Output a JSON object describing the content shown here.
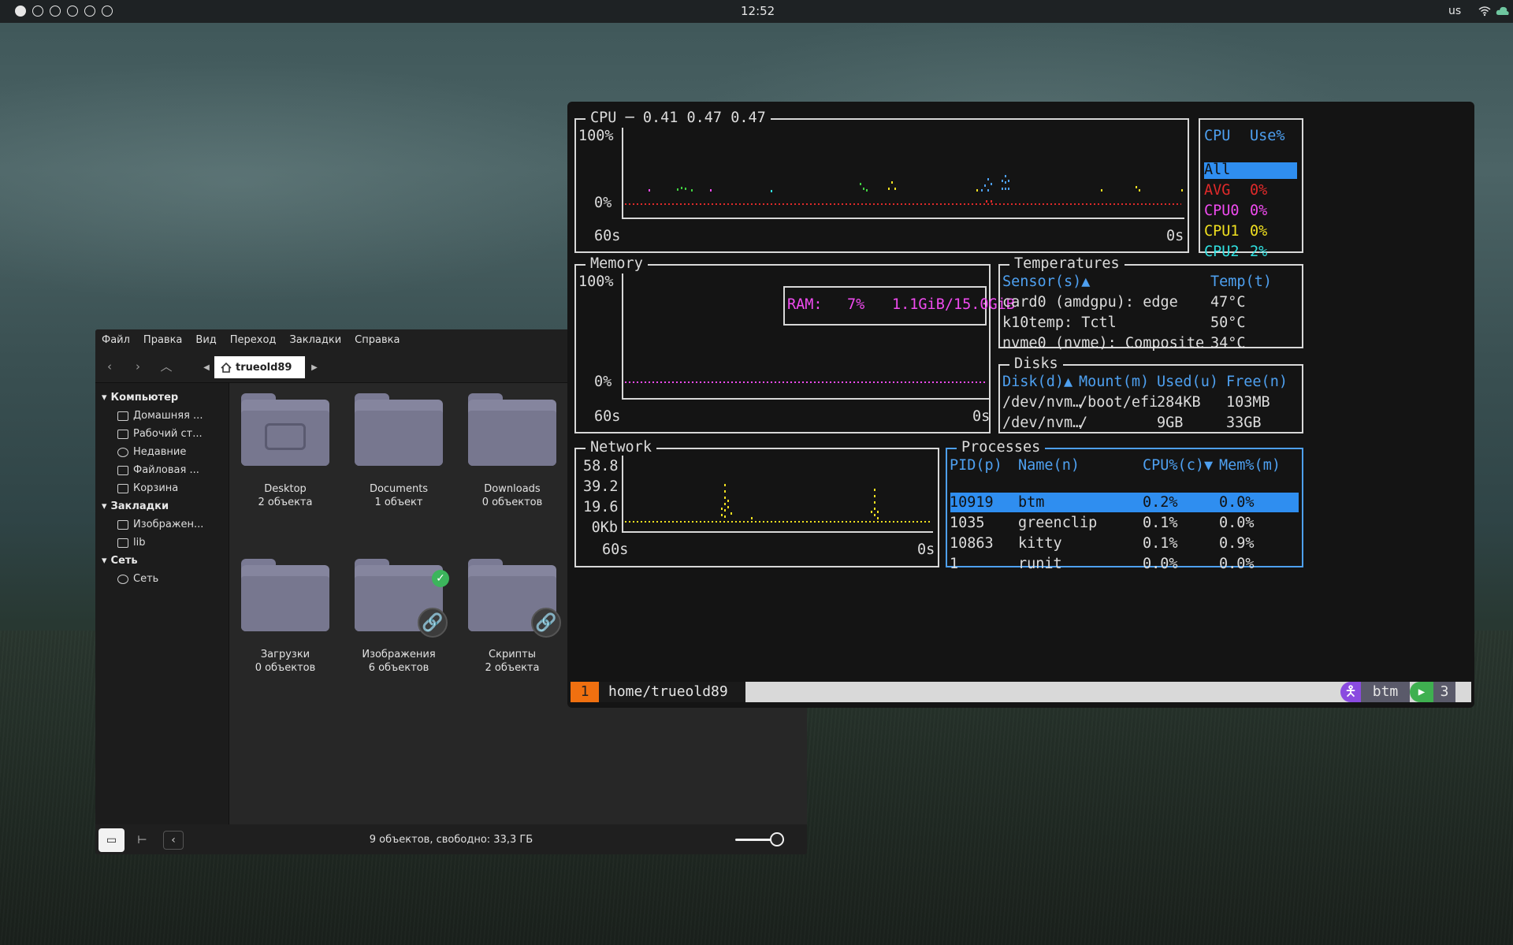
{
  "topbar": {
    "workspaces": [
      true,
      false,
      false,
      false,
      false,
      false
    ],
    "clock": "12:52",
    "keyboard": "us"
  },
  "fm": {
    "menu": [
      "Файл",
      "Правка",
      "Вид",
      "Переход",
      "Закладки",
      "Справка"
    ],
    "path": "trueold89",
    "sidebar": {
      "computer": "Компьютер",
      "computer_items": [
        "Домашняя ...",
        "Рабочий ст...",
        "Недавние",
        "Файловая ...",
        "Корзина"
      ],
      "bookmarks": "Закладки",
      "bookmark_items": [
        "Изображен...",
        "lib"
      ],
      "network": "Сеть",
      "network_items": [
        "Сеть"
      ]
    },
    "items": [
      {
        "name": "Desktop",
        "count": "2 объекта"
      },
      {
        "name": "Documents",
        "count": "1 объект"
      },
      {
        "name": "Downloads",
        "count": "0 объектов"
      },
      {
        "name": "Загрузки",
        "count": "0 объектов"
      },
      {
        "name": "Изображения",
        "count": "6 объектов"
      },
      {
        "name": "Скрипты",
        "count": "2 объекта"
      }
    ],
    "status": "9 объектов, свободно: 33,3 ГБ",
    "zoom_level": 0.85
  },
  "btm": {
    "cpu": {
      "title": "CPU ─ 0.41 0.47 0.47",
      "ymax": "100%",
      "ymin": "0%",
      "xleft": "60s",
      "xright": "0s",
      "legend_h1": "CPU",
      "legend_h2": "Use%",
      "legend": [
        {
          "name": "All",
          "val": ""
        },
        {
          "name": "AVG",
          "val": "0%"
        },
        {
          "name": "CPU0",
          "val": "0%"
        },
        {
          "name": "CPU1",
          "val": "0%"
        },
        {
          "name": "CPU2",
          "val": "2%"
        }
      ]
    },
    "memory": {
      "title": "Memory",
      "ymax": "100%",
      "ymin": "0%",
      "xleft": "60s",
      "xright": "0s",
      "ram_label": "RAM:",
      "ram_pct": "7%",
      "ram_used": "1.1GiB/15.0GiB"
    },
    "temps": {
      "title": "Temperatures",
      "h1": "Sensor(s)▲",
      "h2": "Temp(t)",
      "rows": [
        [
          "card0 (amdgpu): edge",
          "47°C"
        ],
        [
          "k10temp: Tctl",
          "50°C"
        ],
        [
          "nvme0 (nvme): Composite",
          "34°C"
        ]
      ]
    },
    "disks": {
      "title": "Disks",
      "h": [
        "Disk(d)▲",
        "Mount(m)",
        "Used(u)",
        "Free(n)"
      ],
      "rows": [
        [
          "/dev/nvm…",
          "/boot/efi",
          "284KB",
          "103MB"
        ],
        [
          "/dev/nvm…",
          "/",
          "9GB",
          "33GB"
        ]
      ]
    },
    "network": {
      "title": "Network",
      "ticks": [
        "58.8",
        "39.2",
        "19.6",
        "0Kb"
      ],
      "xleft": "60s",
      "xright": "0s"
    },
    "processes": {
      "title": "Processes",
      "h": [
        "PID(p)",
        "Name(n)",
        "CPU%(c)▼",
        "Mem%(m)"
      ],
      "rows": [
        [
          "10919",
          "btm",
          "0.2%",
          "0.0%"
        ],
        [
          "1035",
          "greenclip",
          "0.1%",
          "0.0%"
        ],
        [
          "10863",
          "kitty",
          "0.1%",
          "0.9%"
        ],
        [
          "1",
          "runit",
          "0.0%",
          "0.0%"
        ]
      ]
    }
  },
  "statusline": {
    "num": "1",
    "path": "home/trueold89",
    "app": "btm",
    "count": "3"
  }
}
